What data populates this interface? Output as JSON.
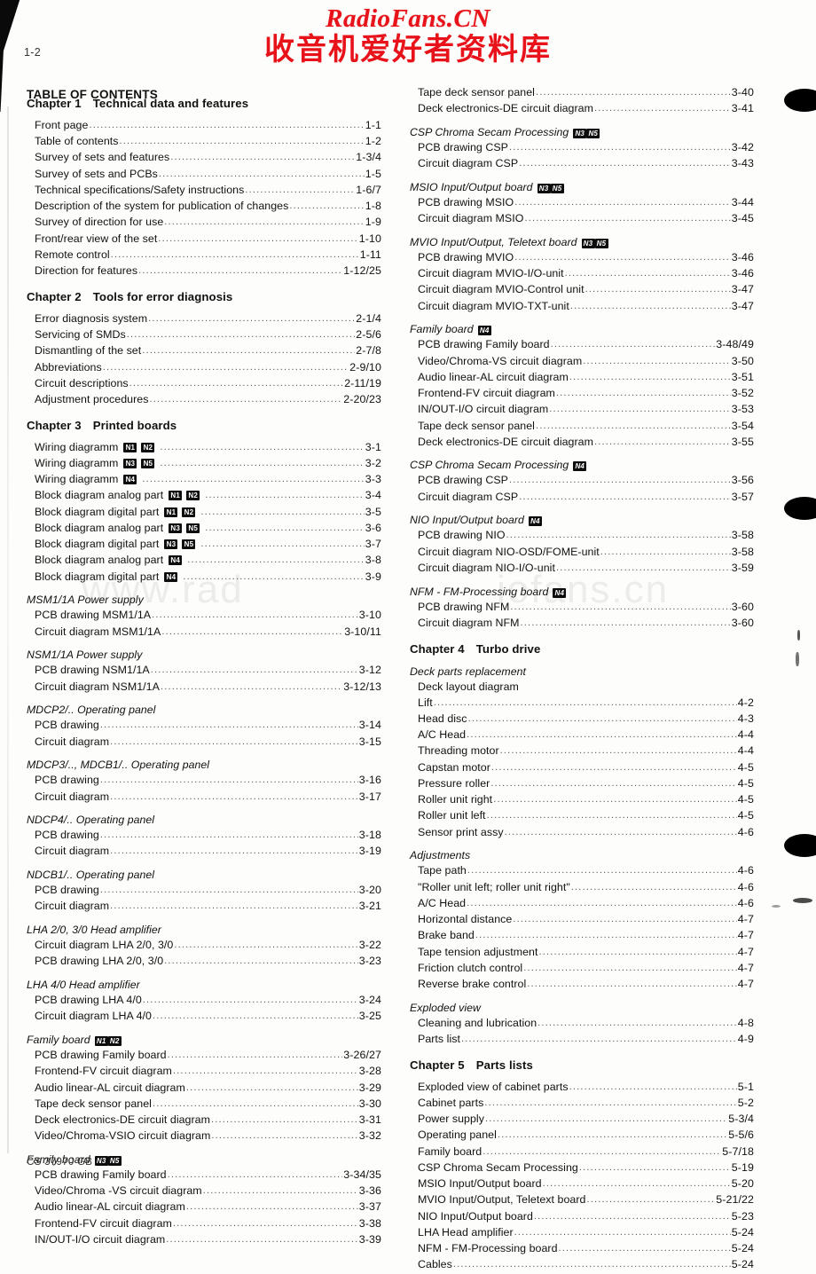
{
  "brand": {
    "english": "RadioFans.CN",
    "chinese": "收音机爱好者资料库",
    "color": "#e8131a"
  },
  "watermark": {
    "left": "www.rad",
    "right": "iofans.cn"
  },
  "folio": "1-2",
  "toc_title": "TABLE OF CONTENTS",
  "footer": "CS 37970 GB",
  "left_column": [
    {
      "type": "chapter",
      "num": "Chapter 1",
      "title": "Technical data and features"
    },
    {
      "type": "entry",
      "label": "Front page",
      "page": "1-1"
    },
    {
      "type": "entry",
      "label": "Table of contents",
      "page": "1-2"
    },
    {
      "type": "entry",
      "label": "Survey of sets and features",
      "page": "1-3/4"
    },
    {
      "type": "entry",
      "label": "Survey of sets and PCBs",
      "page": "1-5"
    },
    {
      "type": "entry",
      "label": "Technical specifications/Safety instructions",
      "page": "1-6/7"
    },
    {
      "type": "entry",
      "label": "Description of the system for publication of changes",
      "page": "1-8"
    },
    {
      "type": "entry",
      "label": "Survey of direction for use",
      "page": "1-9"
    },
    {
      "type": "entry",
      "label": "Front/rear view of the set",
      "page": "1-10"
    },
    {
      "type": "entry",
      "label": "Remote control",
      "page": "1-11"
    },
    {
      "type": "entry",
      "label": "Direction for features",
      "page": "1-12/25"
    },
    {
      "type": "chapter",
      "num": "Chapter 2",
      "title": "Tools for error diagnosis"
    },
    {
      "type": "entry",
      "label": "Error diagnosis system",
      "page": "2-1/4"
    },
    {
      "type": "entry",
      "label": "Servicing of SMDs",
      "page": "2-5/6"
    },
    {
      "type": "entry",
      "label": "Dismantling of the set",
      "page": "2-7/8"
    },
    {
      "type": "entry",
      "label": "Abbreviations",
      "page": "2-9/10"
    },
    {
      "type": "entry",
      "label": "Circuit descriptions",
      "page": "2-11/19"
    },
    {
      "type": "entry",
      "label": "Adjustment procedures",
      "page": "2-20/23"
    },
    {
      "type": "chapter",
      "num": "Chapter 3",
      "title": "Printed boards"
    },
    {
      "type": "entry",
      "label": "Wiring diagramm",
      "badges": [
        "N1",
        "N2"
      ],
      "page": "3-1"
    },
    {
      "type": "entry",
      "label": "Wiring diagramm",
      "badges": [
        "N3",
        "N5"
      ],
      "page": "3-2"
    },
    {
      "type": "entry",
      "label": "Wiring diagramm",
      "badges": [
        "N4"
      ],
      "page": "3-3"
    },
    {
      "type": "entry",
      "label": "Block diagram analog part",
      "badges": [
        "N1",
        "N2"
      ],
      "page": "3-4"
    },
    {
      "type": "entry",
      "label": "Block diagram digital part",
      "badges": [
        "N1",
        "N2"
      ],
      "page": "3-5"
    },
    {
      "type": "entry",
      "label": "Block diagram analog part",
      "badges": [
        "N3",
        "N5"
      ],
      "page": "3-6"
    },
    {
      "type": "entry",
      "label": "Block diagram digital part",
      "badges": [
        "N3",
        "N5"
      ],
      "page": "3-7"
    },
    {
      "type": "entry",
      "label": "Block diagram analog part",
      "badges": [
        "N4"
      ],
      "page": "3-8"
    },
    {
      "type": "entry",
      "label": "Block diagram digital part",
      "badges": [
        "N4"
      ],
      "page": "3-9"
    },
    {
      "type": "group",
      "label": "MSM1/1A Power supply"
    },
    {
      "type": "entry",
      "label": "PCB drawing MSM1/1A",
      "page": "3-10"
    },
    {
      "type": "entry",
      "label": "Circuit diagram MSM1/1A",
      "page": "3-10/11"
    },
    {
      "type": "group",
      "label": "NSM1/1A Power supply"
    },
    {
      "type": "entry",
      "label": "PCB drawing NSM1/1A",
      "page": "3-12"
    },
    {
      "type": "entry",
      "label": "Circuit diagram NSM1/1A",
      "page": "3-12/13"
    },
    {
      "type": "group",
      "label": "MDCP2/.. Operating panel"
    },
    {
      "type": "entry",
      "label": "PCB drawing",
      "page": "3-14"
    },
    {
      "type": "entry",
      "label": "Circuit diagram",
      "page": "3-15"
    },
    {
      "type": "group",
      "label": "MDCP3/.., MDCB1/.. Operating panel"
    },
    {
      "type": "entry",
      "label": "PCB drawing",
      "page": "3-16"
    },
    {
      "type": "entry",
      "label": "Circuit diagram",
      "page": "3-17"
    },
    {
      "type": "group",
      "label": "NDCP4/.. Operating panel"
    },
    {
      "type": "entry",
      "label": "PCB drawing",
      "page": "3-18"
    },
    {
      "type": "entry",
      "label": "Circuit diagram",
      "page": "3-19"
    },
    {
      "type": "group",
      "label": "NDCB1/.. Operating panel"
    },
    {
      "type": "entry",
      "label": "PCB drawing",
      "page": "3-20"
    },
    {
      "type": "entry",
      "label": "Circuit diagram",
      "page": "3-21"
    },
    {
      "type": "group",
      "label": "LHA 2/0, 3/0 Head amplifier"
    },
    {
      "type": "entry",
      "label": "Circuit diagram LHA 2/0, 3/0",
      "page": "3-22"
    },
    {
      "type": "entry",
      "label": "PCB drawing LHA 2/0, 3/0",
      "page": "3-23"
    },
    {
      "type": "group",
      "label": "LHA 4/0 Head amplifier"
    },
    {
      "type": "entry",
      "label": "PCB drawing LHA 4/0",
      "page": "3-24"
    },
    {
      "type": "entry",
      "label": "Circuit diagram LHA 4/0",
      "page": "3-25"
    },
    {
      "type": "group",
      "label": "Family board",
      "badges": [
        "N1",
        "N2"
      ]
    },
    {
      "type": "entry",
      "label": "PCB drawing Family board",
      "page": "3-26/27"
    },
    {
      "type": "entry",
      "label": "Frontend-FV circuit diagram",
      "page": "3-28"
    },
    {
      "type": "entry",
      "label": "Audio linear-AL circuit diagram",
      "page": "3-29"
    },
    {
      "type": "entry",
      "label": "Tape deck sensor panel",
      "page": "3-30"
    },
    {
      "type": "entry",
      "label": "Deck electronics-DE circuit diagram",
      "page": "3-31"
    },
    {
      "type": "entry",
      "label": "Video/Chroma-VSIO circuit diagram",
      "page": "3-32"
    },
    {
      "type": "group",
      "label": "Family board",
      "badges": [
        "N3",
        "N5"
      ]
    },
    {
      "type": "entry",
      "label": "PCB drawing Family board",
      "page": "3-34/35"
    },
    {
      "type": "entry",
      "label": "Video/Chroma -VS circuit diagram",
      "page": "3-36"
    },
    {
      "type": "entry",
      "label": "Audio linear-AL circuit diagram",
      "page": "3-37"
    },
    {
      "type": "entry",
      "label": "Frontend-FV circuit diagram",
      "page": "3-38"
    },
    {
      "type": "entry",
      "label": "IN/OUT-I/O circuit diagram",
      "page": "3-39"
    }
  ],
  "right_column": [
    {
      "type": "entry",
      "label": "Tape deck sensor panel",
      "page": "3-40"
    },
    {
      "type": "entry",
      "label": "Deck electronics-DE circuit diagram",
      "page": "3-41"
    },
    {
      "type": "group",
      "label": "CSP Chroma Secam Processing",
      "badges": [
        "N3",
        "N5"
      ]
    },
    {
      "type": "entry",
      "label": "PCB drawing CSP",
      "page": "3-42"
    },
    {
      "type": "entry",
      "label": "Circuit diagram CSP",
      "page": "3-43"
    },
    {
      "type": "group",
      "label": "MSIO Input/Output board",
      "badges": [
        "N3",
        "N5"
      ]
    },
    {
      "type": "entry",
      "label": "PCB drawing MSIO",
      "page": "3-44"
    },
    {
      "type": "entry",
      "label": "Circuit diagram MSIO",
      "page": "3-45"
    },
    {
      "type": "group",
      "label": "MVIO Input/Output, Teletext board",
      "badges": [
        "N3",
        "N5"
      ]
    },
    {
      "type": "entry",
      "label": "PCB drawing MVIO",
      "page": "3-46"
    },
    {
      "type": "entry",
      "label": "Circuit diagram MVIO-I/O-unit",
      "page": "3-46"
    },
    {
      "type": "entry",
      "label": "Circuit diagram MVIO-Control unit",
      "page": "3-47"
    },
    {
      "type": "entry",
      "label": "Circuit diagram MVIO-TXT-unit",
      "page": "3-47"
    },
    {
      "type": "group",
      "label": "Family board",
      "badges": [
        "N4"
      ]
    },
    {
      "type": "entry",
      "label": "PCB drawing Family board",
      "page": "3-48/49"
    },
    {
      "type": "entry",
      "label": "Video/Chroma-VS circuit diagram",
      "page": "3-50"
    },
    {
      "type": "entry",
      "label": "Audio linear-AL circuit diagram",
      "page": "3-51"
    },
    {
      "type": "entry",
      "label": "Frontend-FV circuit diagram",
      "page": "3-52"
    },
    {
      "type": "entry",
      "label": "IN/OUT-I/O circuit diagram",
      "page": "3-53"
    },
    {
      "type": "entry",
      "label": "Tape deck sensor panel",
      "page": "3-54"
    },
    {
      "type": "entry",
      "label": "Deck electronics-DE circuit diagram",
      "page": "3-55"
    },
    {
      "type": "group",
      "label": "CSP Chroma Secam Processing",
      "badges": [
        "N4"
      ]
    },
    {
      "type": "entry",
      "label": "PCB drawing CSP",
      "page": "3-56"
    },
    {
      "type": "entry",
      "label": "Circuit diagram CSP",
      "page": "3-57"
    },
    {
      "type": "group",
      "label": "NIO Input/Output board",
      "badges": [
        "N4"
      ]
    },
    {
      "type": "entry",
      "label": "PCB drawing NIO",
      "page": "3-58"
    },
    {
      "type": "entry",
      "label": "Circuit diagram NIO-OSD/FOME-unit",
      "page": "3-58"
    },
    {
      "type": "entry",
      "label": "Circuit diagram NIO-I/O-unit",
      "page": "3-59"
    },
    {
      "type": "group",
      "label": "NFM - FM-Processing board",
      "badges": [
        "N4"
      ]
    },
    {
      "type": "entry",
      "label": "PCB drawing NFM",
      "page": "3-60"
    },
    {
      "type": "entry",
      "label": "Circuit diagram NFM",
      "page": "3-60"
    },
    {
      "type": "chapter",
      "num": "Chapter 4",
      "title": "Turbo drive"
    },
    {
      "type": "group",
      "label": "Deck parts replacement"
    },
    {
      "type": "entry",
      "label": "Deck layout diagram",
      "page": "",
      "nodots": true
    },
    {
      "type": "entry",
      "label": "Lift",
      "page": "4-2"
    },
    {
      "type": "entry",
      "label": "Head disc",
      "page": "4-3"
    },
    {
      "type": "entry",
      "label": "A/C Head",
      "page": "4-4"
    },
    {
      "type": "entry",
      "label": "Threading motor",
      "page": "4-4"
    },
    {
      "type": "entry",
      "label": "Capstan motor",
      "page": "4-5"
    },
    {
      "type": "entry",
      "label": "Pressure roller",
      "page": "4-5"
    },
    {
      "type": "entry",
      "label": "Roller unit right",
      "page": "4-5"
    },
    {
      "type": "entry",
      "label": "Roller unit left",
      "page": "4-5"
    },
    {
      "type": "entry",
      "label": "Sensor print assy",
      "page": "4-6"
    },
    {
      "type": "group",
      "label": "Adjustments"
    },
    {
      "type": "entry",
      "label": "Tape path",
      "page": "4-6"
    },
    {
      "type": "entry",
      "label": "\"Roller unit left; roller unit right\"",
      "page": "4-6"
    },
    {
      "type": "entry",
      "label": "A/C Head",
      "page": "4-6"
    },
    {
      "type": "entry",
      "label": "Horizontal distance",
      "page": "4-7"
    },
    {
      "type": "entry",
      "label": "Brake band",
      "page": "4-7"
    },
    {
      "type": "entry",
      "label": "Tape tension adjustment",
      "page": "4-7"
    },
    {
      "type": "entry",
      "label": "Friction clutch control",
      "page": "4-7"
    },
    {
      "type": "entry",
      "label": "Reverse brake control",
      "page": "4-7"
    },
    {
      "type": "group",
      "label": "Exploded view"
    },
    {
      "type": "entry",
      "label": "Cleaning and lubrication",
      "page": "4-8"
    },
    {
      "type": "entry",
      "label": "Parts list",
      "page": "4-9"
    },
    {
      "type": "chapter",
      "num": "Chapter 5",
      "title": "Parts lists"
    },
    {
      "type": "entry",
      "label": "Exploded view of cabinet parts",
      "page": "5-1"
    },
    {
      "type": "entry",
      "label": "Cabinet parts",
      "page": "5-2"
    },
    {
      "type": "entry",
      "label": "Power supply",
      "page": "5-3/4"
    },
    {
      "type": "entry",
      "label": "Operating panel",
      "page": "5-5/6"
    },
    {
      "type": "entry",
      "label": "Family board",
      "page": "5-7/18"
    },
    {
      "type": "entry",
      "label": "CSP Chroma Secam Processing",
      "page": "5-19"
    },
    {
      "type": "entry",
      "label": "MSIO Input/Output board",
      "page": "5-20"
    },
    {
      "type": "entry",
      "label": "MVIO Input/Output, Teletext board",
      "page": "5-21/22"
    },
    {
      "type": "entry",
      "label": "NIO Input/Output board",
      "page": "5-23"
    },
    {
      "type": "entry",
      "label": "LHA Head amplifier",
      "page": "5-24"
    },
    {
      "type": "entry",
      "label": "NFM - FM-Processing board",
      "page": "5-24"
    },
    {
      "type": "entry",
      "label": "Cables",
      "page": "5-24"
    }
  ]
}
